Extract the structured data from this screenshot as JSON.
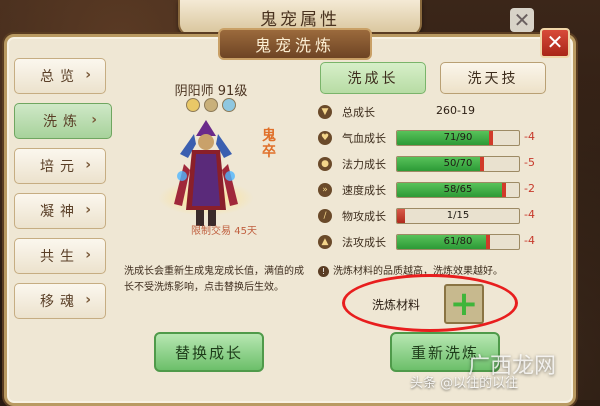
{
  "window": {
    "title": "鬼宠属性",
    "close_label": "✕"
  },
  "panel": {
    "title": "鬼宠洗炼",
    "close_label": "✕"
  },
  "nav": {
    "items": [
      {
        "label": "总览",
        "arrow": "›"
      },
      {
        "label": "洗炼",
        "arrow": "›"
      },
      {
        "label": "培元",
        "arrow": "›"
      },
      {
        "label": "凝神",
        "arrow": "›"
      },
      {
        "label": "共生",
        "arrow": "›"
      },
      {
        "label": "移魂",
        "arrow": "›"
      }
    ],
    "active_index": 1
  },
  "character": {
    "name": "阴阳师 91级",
    "side_label": "鬼卒",
    "trade_limit": "限制交易 45天",
    "element_icons": [
      "fire-icon",
      "earth-icon",
      "water-icon"
    ]
  },
  "description": "洗成长会重新生成鬼宠成长值，满值的成长不受洗炼影响，点击替换后生效。",
  "tabs": [
    {
      "label": "洗成长",
      "active": true
    },
    {
      "label": "洗天技",
      "active": false
    }
  ],
  "stats": {
    "total": {
      "label": "总成长",
      "value": "260-19"
    },
    "rows": [
      {
        "label": "气血成长",
        "text": "71/90",
        "current": 71,
        "max": 90,
        "delta": "-4",
        "icon": "heart-icon"
      },
      {
        "label": "法力成长",
        "text": "50/70",
        "current": 50,
        "max": 70,
        "delta": "-5",
        "icon": "drop-icon"
      },
      {
        "label": "速度成长",
        "text": "58/65",
        "current": 58,
        "max": 65,
        "delta": "-2",
        "icon": "speed-icon"
      },
      {
        "label": "物攻成长",
        "text": "1/15",
        "current": 1,
        "max": 15,
        "delta": "-4",
        "icon": "sword-icon"
      },
      {
        "label": "法攻成长",
        "text": "61/80",
        "current": 61,
        "max": 80,
        "delta": "-4",
        "icon": "magic-icon"
      }
    ]
  },
  "note": "洗炼材料的品质越高，洗炼效果越好。",
  "material": {
    "label": "洗炼材料",
    "add_icon": "plus-icon"
  },
  "buttons": {
    "replace": "替换成长",
    "wash": "重新洗炼"
  },
  "watermark": {
    "text": "头条 @以往的以往",
    "logo": "广西龙网"
  }
}
